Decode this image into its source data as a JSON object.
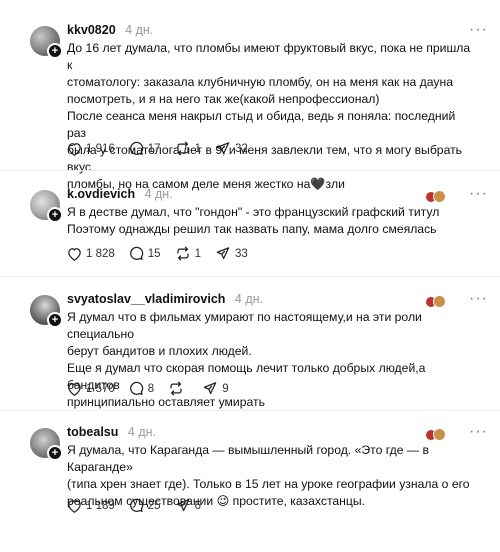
{
  "posts": [
    {
      "username": "kkv0820",
      "time": "4 дн.",
      "lines": [
        "До 16 лет думала, что пломбы имеют фруктовый вкус, пока не пришла к",
        "стоматологу: заказала клубничную пломбу, он на меня как на дауна",
        "посмотреть, и я на него так же(какой непрофессионал)",
        "После сеанса меня накрыл стыд и обида, ведь я поняла: последний раз",
        "была у стоматолога лет в 9, и меня завлекли тем, что я могу выбрать вкус",
        "пломбы, но на самом деле меня жестко на🖤зли"
      ],
      "likes": "1 916",
      "comments": "17",
      "reposts": "1",
      "shares": "32"
    },
    {
      "username": "k.ovdievich",
      "time": "4 дн.",
      "lines": [
        "Я в дестве думал, что \"гондон\" - это французский графский титул",
        "Поэтому однажды решил так назвать папу, мама долго смеялась"
      ],
      "likes": "1 828",
      "comments": "15",
      "reposts": "1",
      "shares": "33"
    },
    {
      "username": "svyatoslav__vladimirovich",
      "time": "4 дн.",
      "lines": [
        "Я думал что в фильмах умирают по настоящему,и на эти роли специально",
        "берут бандитов и плохих людей.",
        "Еще я думал что скорая помощь лечит только добрых людей,а бандитов",
        "принципиально оставляет умирать"
      ],
      "likes": "1 570",
      "comments": "8",
      "shares": "9"
    },
    {
      "username": "tobealsu",
      "time": "4 дн.",
      "lines": [
        "Я думала, что Караганда — вымышленный город. «Это где — в Караганде»",
        "(типа хрен знает где). Только в 15 лет на уроке географии узнала о его",
        "реальном существовании 😉 простите, казахстанцы."
      ],
      "likes": "1 189",
      "comments": "25",
      "shares": "6"
    }
  ],
  "icons": {
    "like": "heart-icon",
    "comment": "comment-icon",
    "repost": "repost-icon",
    "share": "share-icon",
    "more": "more-icon"
  },
  "more_glyph": "···"
}
